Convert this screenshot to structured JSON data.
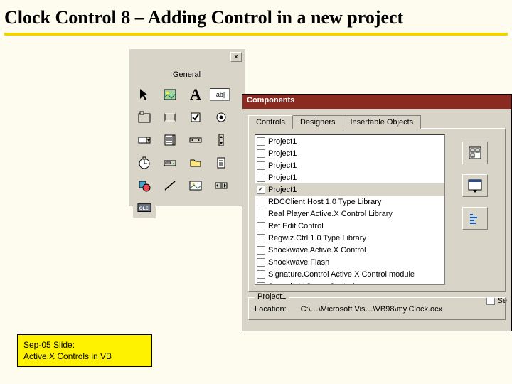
{
  "slide": {
    "title": "Clock Control 8 – Adding Control in a new project"
  },
  "toolbox": {
    "label": "General"
  },
  "dialog": {
    "title": "Components",
    "tabs": {
      "t0": "Controls",
      "t1": "Designers",
      "t2": "Insertable Objects"
    },
    "list": {
      "i0": "Project1",
      "i1": "Project1",
      "i2": "Project1",
      "i3": "Project1",
      "i4": "Project1",
      "i5": "RDCClient.Host 1.0 Type Library",
      "i6": "Real Player Active.X Control Library",
      "i7": "Ref Edit Control",
      "i8": "Regwiz.Ctrl 1.0 Type Library",
      "i9": "Shockwave Active.X Control",
      "i10": "Shockwave Flash",
      "i11": "Signature.Control Active.X Control module",
      "i12": "Snapshot Viewer Control"
    },
    "se_label": "Se",
    "info_group": "Project1",
    "location_label": "Location:",
    "location_value": "C:\\…\\Microsoft Vis…\\VB98\\my.Clock.ocx"
  },
  "footer": {
    "line1": "Sep-05 Slide:",
    "line2": "Active.X Controls in VB"
  }
}
